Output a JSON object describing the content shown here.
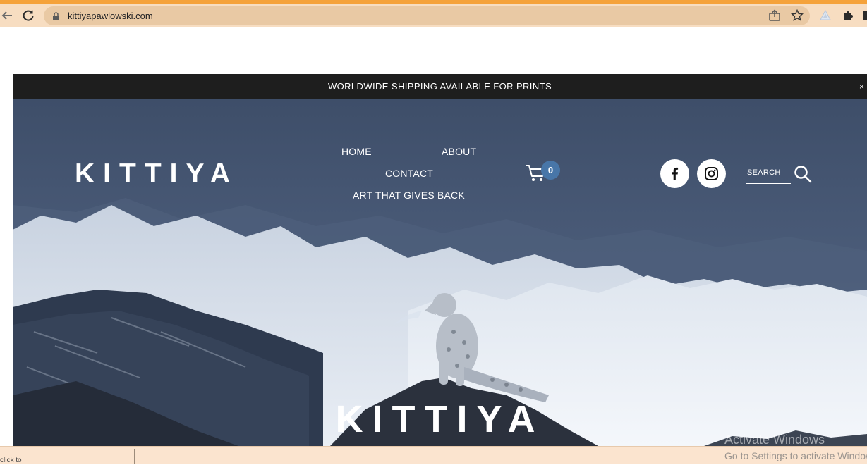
{
  "browser": {
    "url": "kittiyapawlowski.com",
    "icons": [
      "back-arrow-icon",
      "reload-icon",
      "lock-icon",
      "share-icon",
      "star-icon",
      "extension-icon",
      "puzzle-icon"
    ]
  },
  "site": {
    "announcement": "WORLDWIDE SHIPPING AVAILABLE FOR PRINTS",
    "announcement_close": "×",
    "logo": "KITTIYA",
    "nav": {
      "home": "HOME",
      "about": "ABOUT",
      "contact": "CONTACT",
      "art": "ART THAT GIVES BACK"
    },
    "cart_count": "0",
    "search_label": "SEARCH",
    "hero_title": "KITTIYA",
    "colors": {
      "announcement_bg": "#1e1e1e",
      "cart_badge": "#4876a8",
      "browser_bar": "#f7ddc1",
      "accent": "#f5a23a"
    }
  },
  "windows_watermark": {
    "line1": "Activate Windows",
    "line2": "Go to Settings to activate Windows."
  },
  "status_bar": {
    "fragment": "click to"
  }
}
